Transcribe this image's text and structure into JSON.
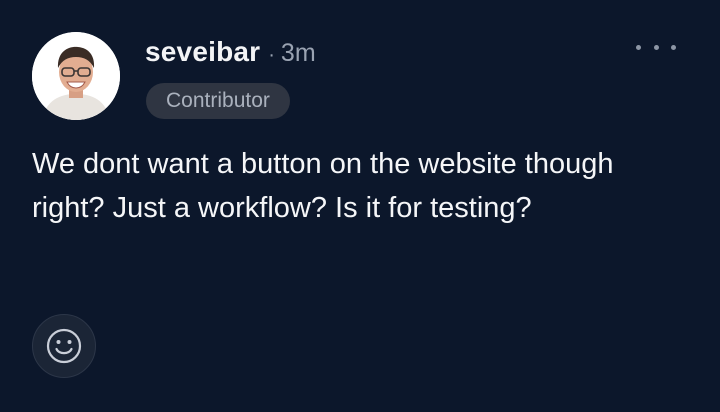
{
  "post": {
    "username": "seveibar",
    "separator": "·",
    "time": "3m",
    "badge": "Contributor",
    "message": "We dont want a button on the website though right? Just a workflow? Is it for testing?"
  },
  "icons": {
    "avatar": "avatar-photo",
    "more": "more-horizontal-icon",
    "reaction": "smiley-face-icon"
  },
  "colors": {
    "background": "#0c172b",
    "text": "#f5f6f8",
    "muted": "#9aa3b2",
    "badge_bg": "#2f3542"
  }
}
